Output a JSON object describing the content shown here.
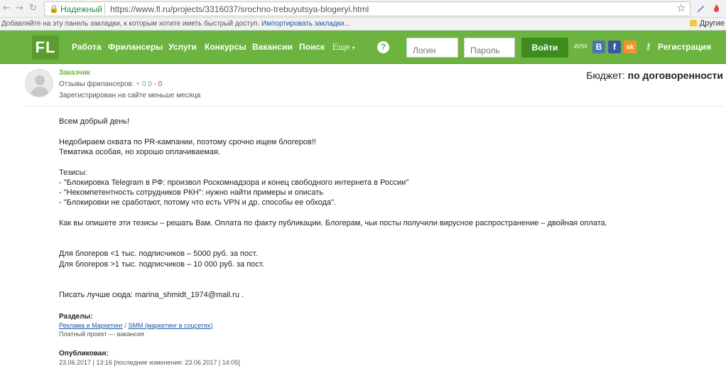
{
  "browser": {
    "secure_label": "Надежный",
    "url": "https://www.fl.ru/projects/3316037/srochno-trebuyutsya-blogeryi.html",
    "bookmarks_hint": "Добавляйте на эту панель закладки, к которым хотите иметь быстрый доступ.",
    "bookmarks_import": "Импортировать закладки...",
    "other_bookmarks": "Другие"
  },
  "nav": {
    "logo": "FL",
    "items": [
      "Работа",
      "Фрилансеры",
      "Услуги",
      "Конкурсы",
      "Вакансии",
      "Поиск"
    ],
    "more": "Еще",
    "help": "?",
    "login_placeholder": "Логин",
    "password_placeholder": "Пароль",
    "login_button": "Войти",
    "or": "или",
    "social": [
      "B",
      "f",
      "ok"
    ],
    "register": "Регистрация",
    "colors": {
      "accent": "#6db33f",
      "button": "#3d8c1e"
    }
  },
  "project": {
    "customer": "Заказчик",
    "reviews_label": "Отзывы фрилансеров:",
    "reviews_pos": "+ 0",
    "reviews_zero": "0",
    "reviews_neg": "- 0",
    "registered": "Зарегистрирован на сайте меньше месяца",
    "budget_label": "Бюджет:",
    "budget_value": "по договоренности",
    "body": {
      "greeting": "Всем добрый день!",
      "p1": "Недобираем охвата по PR-кампании, поэтому срочно ищем блогеров!!",
      "p2": "Тематика особая, но хорошо оплачиваемая.",
      "theses_title": "Тезисы:",
      "thesis1": "- \"Блокировка Telegram в РФ: произвол Роскомнадзора и конец свободного интернета в России\"",
      "thesis2": "- \"Некомпетентность сотрудников РКН\": нужно найти примеры и описать",
      "thesis3": "- \"Блокировки не сработают, потому что есть VPN и др. способы ее обхода\".",
      "payment": "Как вы опишете эти тезисы – решать Вам. Оплата по факту публикации. Блогерам, чьи посты получили вирусное распространение – двойная оплата.",
      "price1": "Для блогеров <1 тыс. подписчиков – 5000 руб. за пост.",
      "price2": "Для блогеров >1 тыс. подписчиков – 10 000 руб. за пост.",
      "contact": "Писать лучше сюда: marina_shmidt_1974@mail.ru ."
    },
    "sections_title": "Разделы:",
    "section1": "Реклама и Маркетинг",
    "section_sep": "/",
    "section2": "SMM (маркетинг в соцсетях)",
    "project_type": "Платный проект — вакансия",
    "published_title": "Опубликован:",
    "published": "23.06.2017 | 13:16 [последние изменения: 23.06.2017 | 14:05]"
  }
}
